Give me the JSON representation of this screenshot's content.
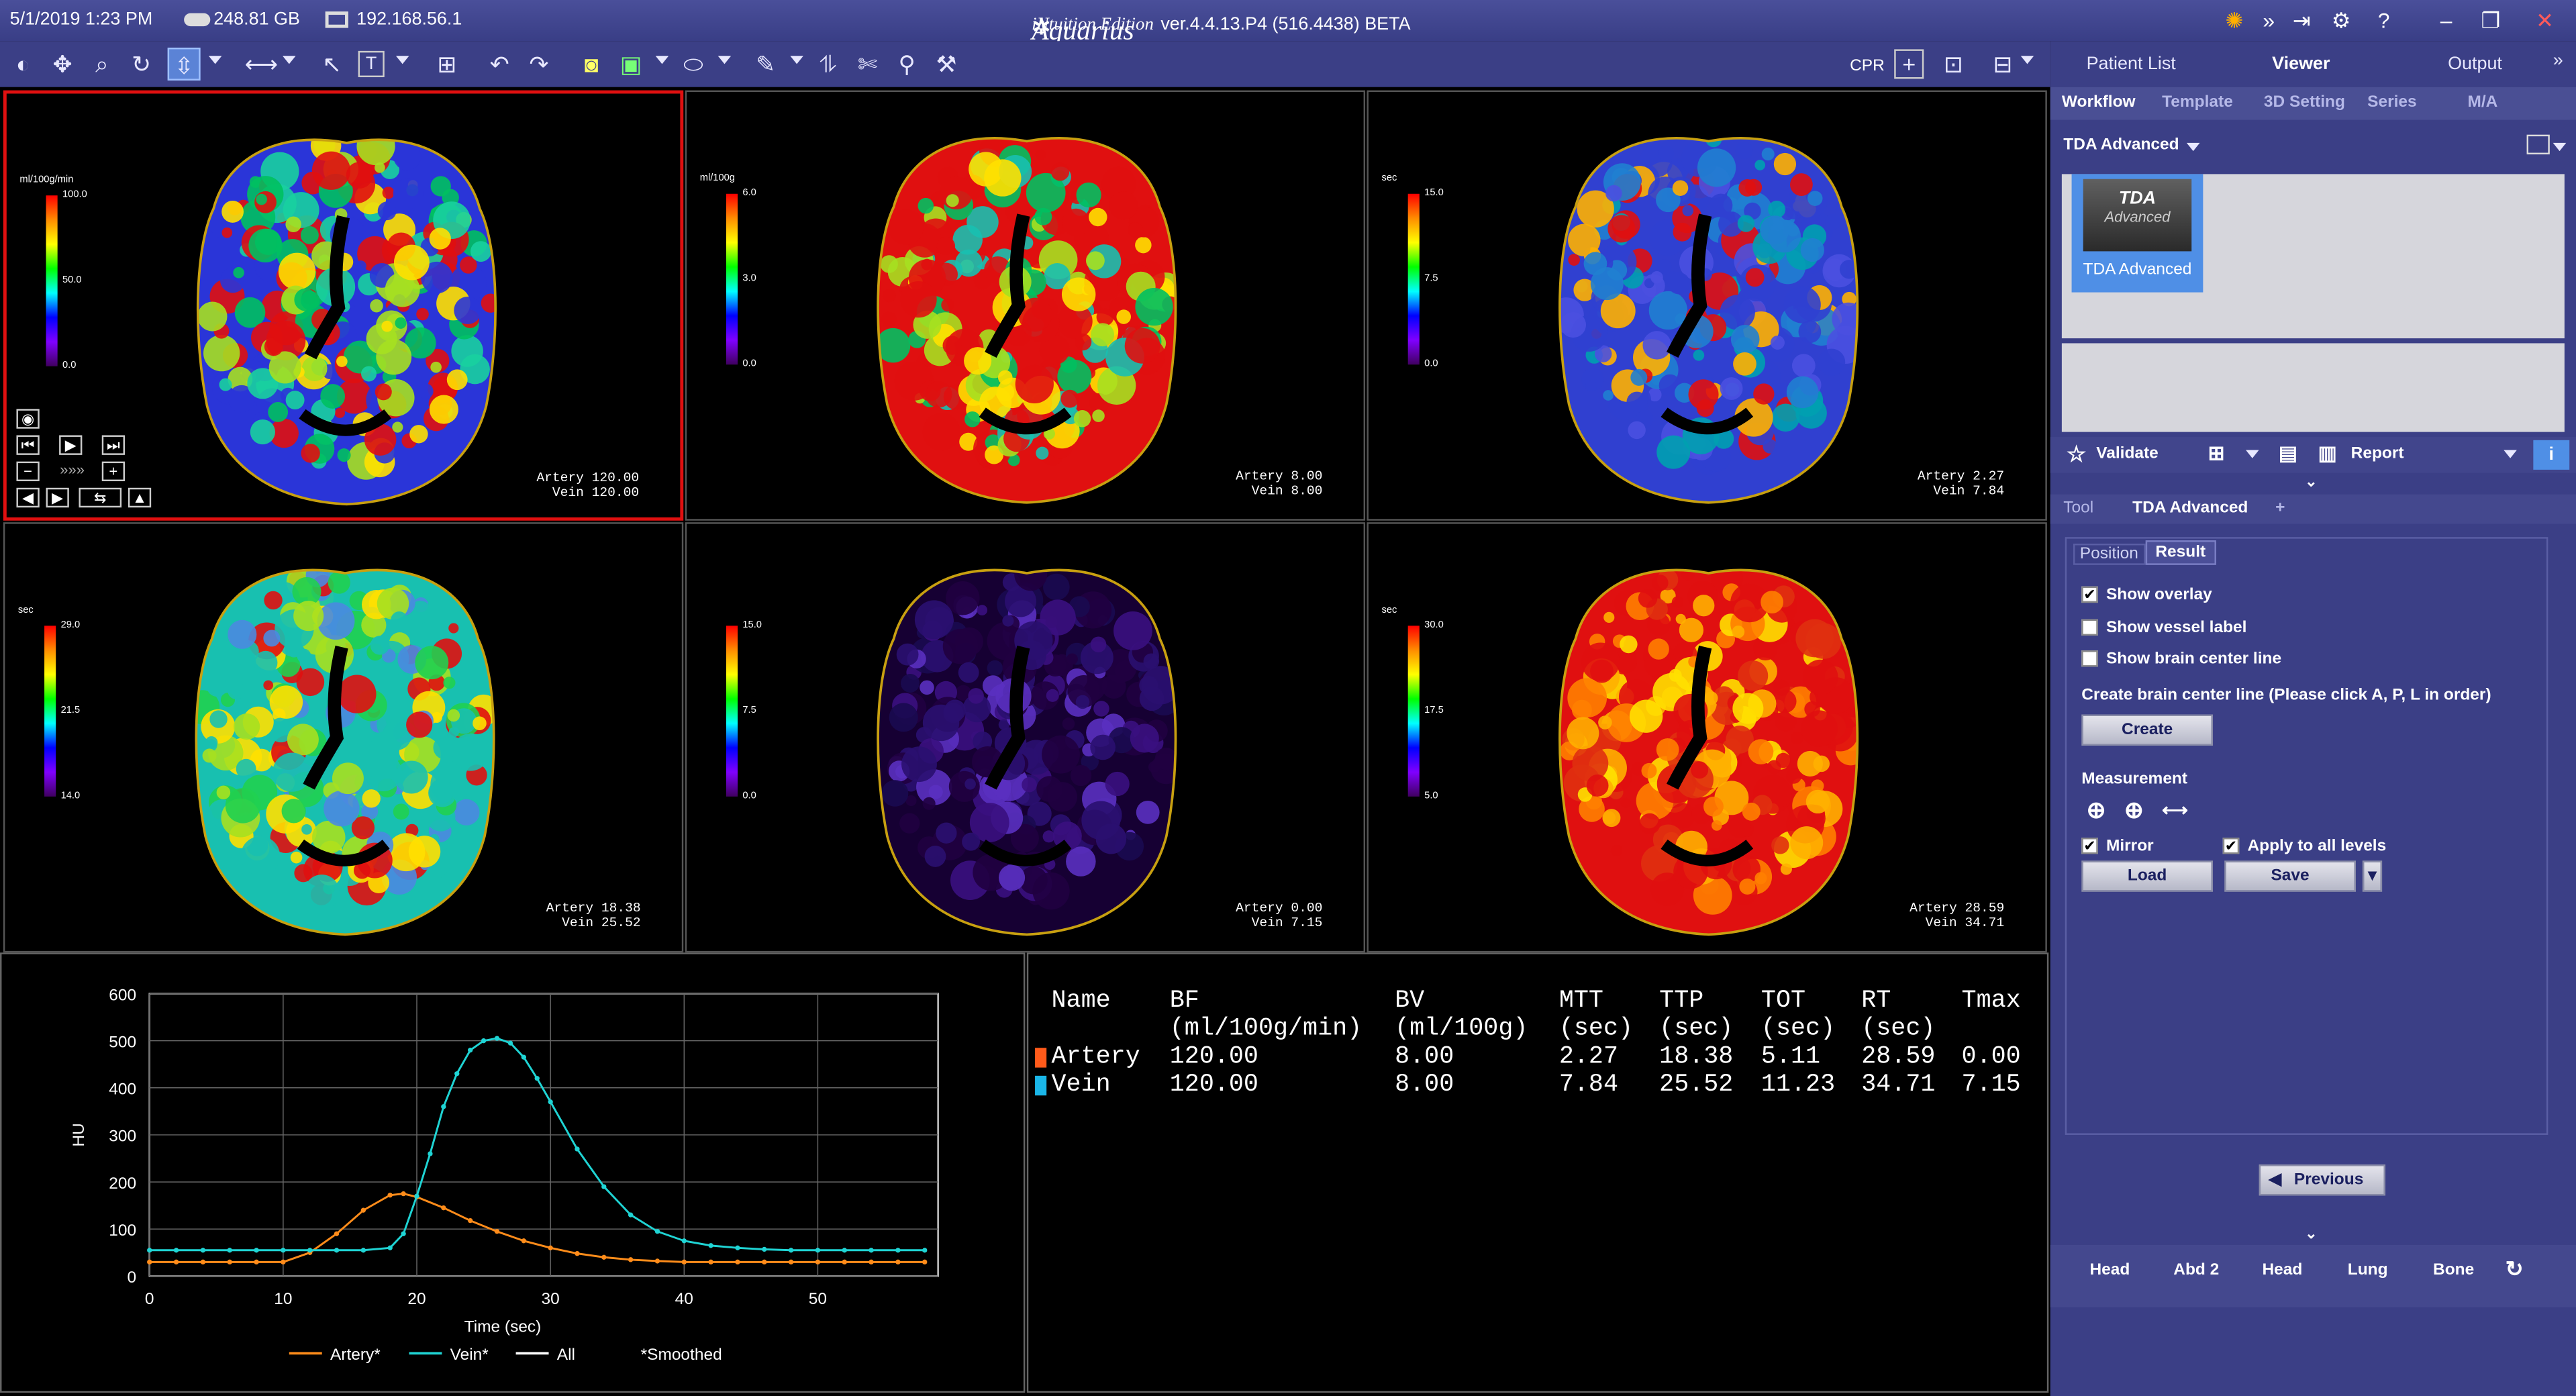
{
  "status": {
    "datetime": "5/1/2019  1:23 PM",
    "disk": "248.81 GB",
    "ip": "192.168.56.1",
    "app_name": "Aquarius",
    "app_sub": "iNtuition Edition",
    "version": "ver.4.4.13.P4 (516.4438) BETA"
  },
  "toolbar": {
    "cpr_label": "CPR"
  },
  "main_tabs": [
    "Patient List",
    "Viewer",
    "Output"
  ],
  "workflow_tabs": [
    "Workflow",
    "Template",
    "3D Setting",
    "Series",
    "M/A"
  ],
  "tda": {
    "dropdown": "TDA Advanced",
    "thumb_title": "TDA",
    "thumb_sub": "Advanced",
    "thumb_label": "TDA Advanced",
    "validate": "Validate",
    "report": "Report"
  },
  "tool_tabs": {
    "tool": "Tool",
    "active": "TDA Advanced",
    "plus": "+"
  },
  "result_tabs": [
    "Position",
    "Result"
  ],
  "options": {
    "show_overlay": "Show overlay",
    "show_vessel_label": "Show vessel label",
    "show_brain_center": "Show brain center line",
    "create_instruction": "Create brain center line (Please click A, P, L in order)",
    "create_btn": "Create",
    "measurement": "Measurement",
    "mirror": "Mirror",
    "apply_all": "Apply to all levels",
    "load": "Load",
    "save": "Save",
    "previous": "Previous"
  },
  "bottom_tabs": [
    "Head",
    "Abd 2",
    "Head",
    "Lung",
    "Bone"
  ],
  "viewports": [
    {
      "unit": "ml/100g/min",
      "max": "100.0",
      "mid": "50.0",
      "min": "0.0",
      "artery": "Artery 120.00",
      "vein": "Vein 120.00",
      "palette": "bf"
    },
    {
      "unit": "ml/100g",
      "max": "6.0",
      "mid": "3.0",
      "min": "0.0",
      "artery": "Artery 8.00",
      "vein": "Vein 8.00",
      "palette": "bv"
    },
    {
      "unit": "sec",
      "max": "15.0",
      "mid": "7.5",
      "min": "0.0",
      "artery": "Artery 2.27",
      "vein": "Vein 7.84",
      "palette": "mtt"
    },
    {
      "unit": "sec",
      "max": "29.0",
      "mid": "21.5",
      "min": "14.0",
      "artery": "Artery 18.38",
      "vein": "Vein 25.52",
      "palette": "ttp"
    },
    {
      "unit": "",
      "max": "15.0",
      "mid": "7.5",
      "min": "0.0",
      "artery": "Artery 0.00",
      "vein": "Vein 7.15",
      "palette": "tmax"
    },
    {
      "unit": "sec",
      "max": "30.0",
      "mid": "17.5",
      "min": "5.0",
      "artery": "Artery 28.59",
      "vein": "Vein 34.71",
      "palette": "rt"
    }
  ],
  "results_table": {
    "headers": [
      [
        "Name",
        ""
      ],
      [
        "BF",
        "(ml/100g/min)"
      ],
      [
        "BV",
        "(ml/100g)"
      ],
      [
        "MTT",
        "(sec)"
      ],
      [
        "TTP",
        "(sec)"
      ],
      [
        "TOT",
        "(sec)"
      ],
      [
        "RT",
        "(sec)"
      ],
      [
        "Tmax",
        ""
      ]
    ],
    "rows": [
      {
        "name": "Artery",
        "color": "#ff5a1a",
        "values": [
          "120.00",
          "8.00",
          "2.27",
          "18.38",
          "5.11",
          "28.59",
          "0.00"
        ]
      },
      {
        "name": "Vein",
        "color": "#1ab6e8",
        "values": [
          "120.00",
          "8.00",
          "7.84",
          "25.52",
          "11.23",
          "34.71",
          "7.15"
        ]
      }
    ]
  },
  "chart_data": {
    "type": "line",
    "xlabel": "Time (sec)",
    "ylabel": "HU",
    "xlim": [
      0,
      59
    ],
    "ylim": [
      0,
      600
    ],
    "xticks": [
      0,
      10,
      20,
      30,
      40,
      50
    ],
    "yticks": [
      0,
      100,
      200,
      300,
      400,
      500,
      600
    ],
    "grid": true,
    "legend": [
      "Artery*",
      "Vein*",
      "All",
      "*Smoothed"
    ],
    "series": [
      {
        "name": "Artery*",
        "color": "#ff8c1a",
        "x": [
          0,
          2,
          4,
          6,
          8,
          10,
          12,
          14,
          16,
          18,
          19,
          20,
          22,
          24,
          26,
          28,
          30,
          32,
          34,
          36,
          38,
          40,
          42,
          44,
          46,
          48,
          50,
          52,
          54,
          56,
          58
        ],
        "values": [
          30,
          30,
          30,
          30,
          30,
          30,
          50,
          90,
          140,
          172,
          175,
          168,
          145,
          118,
          95,
          75,
          60,
          48,
          40,
          35,
          32,
          30,
          30,
          30,
          30,
          30,
          30,
          30,
          30,
          30,
          30
        ]
      },
      {
        "name": "Vein*",
        "color": "#1fd4d4",
        "x": [
          0,
          2,
          4,
          6,
          8,
          10,
          12,
          14,
          16,
          18,
          19,
          20,
          21,
          22,
          23,
          24,
          25,
          26,
          27,
          28,
          29,
          30,
          32,
          34,
          36,
          38,
          40,
          42,
          44,
          46,
          48,
          50,
          52,
          54,
          56,
          58
        ],
        "values": [
          55,
          55,
          55,
          55,
          55,
          55,
          55,
          55,
          55,
          60,
          90,
          170,
          260,
          360,
          430,
          480,
          500,
          505,
          495,
          465,
          420,
          370,
          270,
          190,
          130,
          95,
          75,
          65,
          60,
          57,
          55,
          55,
          55,
          55,
          55,
          55
        ]
      }
    ]
  }
}
